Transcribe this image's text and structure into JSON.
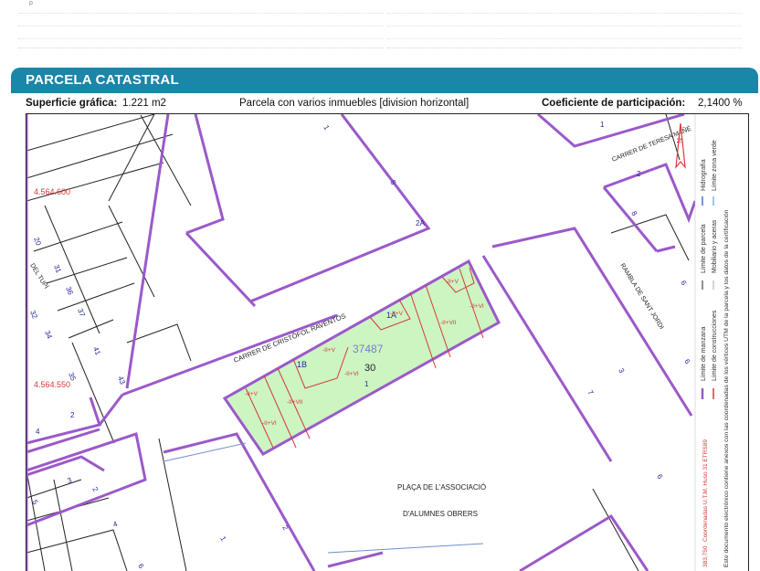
{
  "top": {
    "fragment": "p"
  },
  "section": {
    "title": "PARCELA CATASTRAL"
  },
  "info": {
    "surface_label": "Superficie gráfica:",
    "surface_value": "1.221 m2",
    "description": "Parcela con varios inmuebles [division horizontal]",
    "coef_label": "Coeficiente de participación:",
    "coef_value": "2,1400 %"
  },
  "map": {
    "coord_y_top": "4.564.600",
    "coord_y_bottom": "4.564.550",
    "street_cristofol": "CARRER DE CRISTÒFOL RAVENTÓS",
    "street_teresa": "CARRER DE TERESA MAÑÉ",
    "street_rambla": "RAMBLA DE SANT JORDI",
    "street_tupi": "DEL TUPÍ",
    "placa_line1": "PLAÇA DE L'ASSOCIACIÓ",
    "placa_line2": "D'ALUMNES OBRERS",
    "parcel_id": "37487",
    "parcel_number": "30",
    "sub_1a": "1A",
    "sub_1b": "1B",
    "floors": {
      "f1": "-II+V",
      "f2": "-II+VI",
      "f3": "-II+VII",
      "f4": "-II+V",
      "f5": "-II+VI",
      "f6": "-II+VII",
      "f7": "-II+VI",
      "f8": "-II+V",
      "f9": "-II+VI",
      "f10": "-II+VII",
      "f11": "-II+V"
    },
    "nums": {
      "n1": "1",
      "n5": "5",
      "n2A": "2A",
      "n20": "20",
      "n31": "31",
      "n36": "36",
      "n37": "37",
      "n32": "32",
      "n34": "34",
      "n41": "41",
      "n43": "43",
      "n35": "35",
      "n4a": "4",
      "n2a": "2",
      "n1main": "1",
      "n3": "3",
      "n7": "7",
      "n6": "6",
      "n1top": "1",
      "n2top": "2",
      "n8": "8",
      "n6b": "6",
      "n3b": "3",
      "n2b": "2",
      "n5b": "5",
      "n4b": "4",
      "n6c": "6",
      "n1c": "1",
      "n2c": "2",
      "n6d": "6"
    },
    "north": "N"
  },
  "legend": {
    "limite_manzana": "Límite de manzana",
    "limite_parcela": "Límite de parcela",
    "hidrografia": "Hidrografía",
    "limite_construcciones": "Límite de construcciones",
    "mobiliario": "Mobiliario y aceras",
    "limite_zona_verde": "Límite zona verde",
    "certificacion": "Este documento electrónico contiene anexos con las coordenadas de los vértices UTM de la parcela y los datos de la certificación",
    "coordenadas": "Coordenadas U.T.M. Huso 31 ETRS89",
    "scale": "383,750"
  },
  "colors": {
    "header": "#1a86a8",
    "parcel_fill": "#ccf5c2",
    "block_line": "#9b59c9",
    "construction_line": "#d63a3a",
    "coord_text": "#d63a3a",
    "number_blue": "#23289a"
  }
}
